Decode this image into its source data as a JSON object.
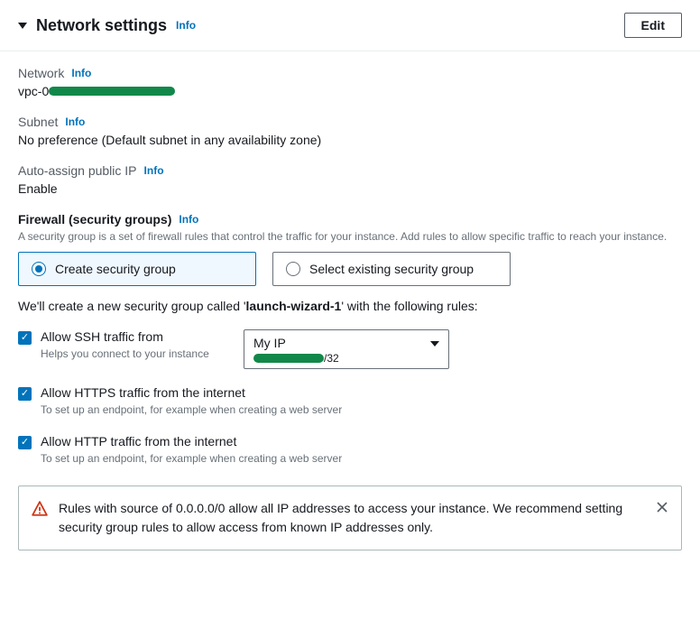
{
  "header": {
    "title": "Network settings",
    "info": "Info",
    "edit_label": "Edit"
  },
  "network": {
    "label": "Network",
    "info": "Info",
    "value_prefix": "vpc-0"
  },
  "subnet": {
    "label": "Subnet",
    "info": "Info",
    "value": "No preference (Default subnet in any availability zone)"
  },
  "auto_ip": {
    "label": "Auto-assign public IP",
    "info": "Info",
    "value": "Enable"
  },
  "firewall": {
    "label": "Firewall (security groups)",
    "info": "Info",
    "helper": "A security group is a set of firewall rules that control the traffic for your instance. Add rules to allow specific traffic to reach your instance.",
    "option_create": "Create security group",
    "option_select": "Select existing security group",
    "description_pre": "We'll create a new security group called '",
    "description_name": "launch-wizard-1",
    "description_post": "' with the following rules:"
  },
  "rules": {
    "ssh": {
      "label": "Allow SSH traffic from",
      "helper": "Helps you connect to your instance",
      "dropdown_value": "My IP",
      "ip_suffix": "/32"
    },
    "https": {
      "label": "Allow HTTPS traffic from the internet",
      "helper": "To set up an endpoint, for example when creating a web server"
    },
    "http": {
      "label": "Allow HTTP traffic from the internet",
      "helper": "To set up an endpoint, for example when creating a web server"
    }
  },
  "alert": {
    "text": "Rules with source of 0.0.0.0/0 allow all IP addresses to access your instance. We recommend setting security group rules to allow access from known IP addresses only."
  }
}
